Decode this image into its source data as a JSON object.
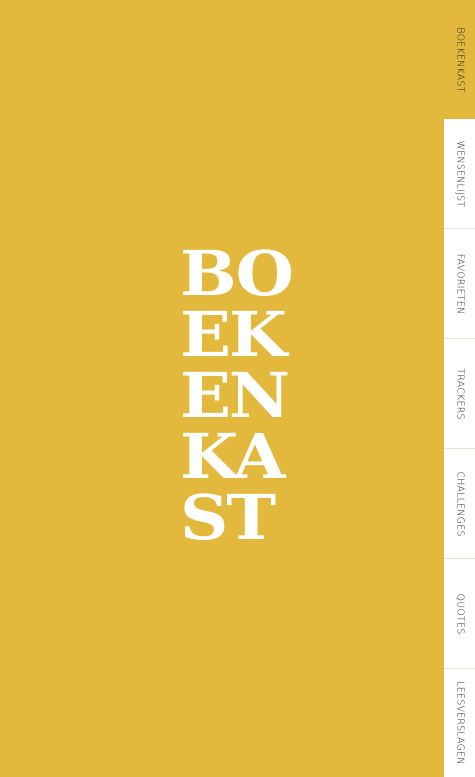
{
  "brand": {
    "lines": [
      "BO",
      "EK",
      "EN",
      "KA",
      "ST"
    ]
  },
  "tabs": [
    {
      "label": "BOEKENKAST",
      "active": true
    },
    {
      "label": "WENSENLIJST",
      "active": false
    },
    {
      "label": "FAVORIETEN",
      "active": false
    },
    {
      "label": "TRACKERS",
      "active": false
    },
    {
      "label": "CHALLENGES",
      "active": false
    },
    {
      "label": "QUOTES",
      "active": false
    },
    {
      "label": "LEESVERSLAGEN",
      "active": false
    }
  ],
  "colors": {
    "accent": "#e3b93d",
    "tab_bg": "#ffffff",
    "logo_text": "#ffffff"
  }
}
